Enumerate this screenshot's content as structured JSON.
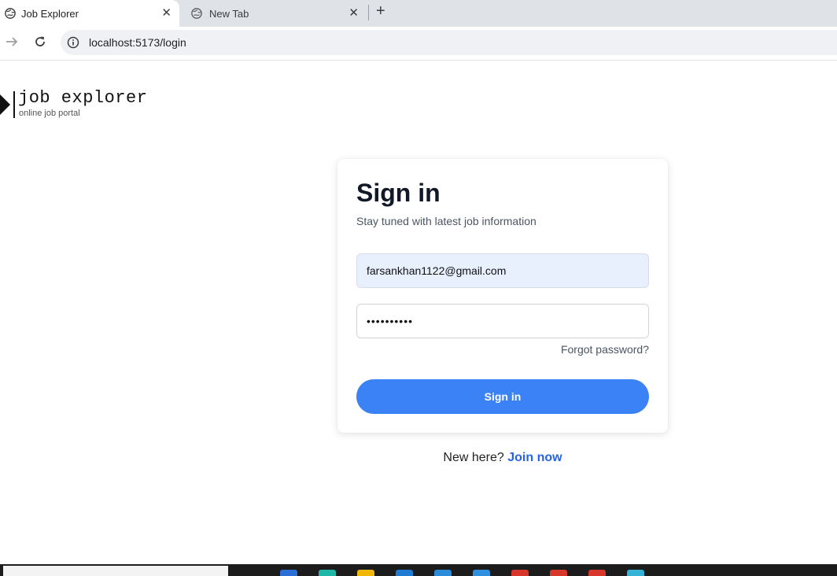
{
  "browser": {
    "tabs": [
      {
        "title": "Job Explorer",
        "active": true
      },
      {
        "title": "New Tab",
        "active": false
      }
    ],
    "url": "localhost:5173/login"
  },
  "logo": {
    "brand": "job explorer",
    "tagline": "online job portal"
  },
  "signin": {
    "heading": "Sign in",
    "subtitle": "Stay tuned with latest job information",
    "email_value": "farsankhan1122@gmail.com",
    "password_value": "••••••••••",
    "forgot_label": "Forgot password?",
    "button_label": "Sign in"
  },
  "signup": {
    "prompt": "New here?",
    "link_label": "Join now"
  },
  "colors": {
    "accent": "#3b82f6",
    "link": "#2563eb",
    "autofill_bg": "#e8f0fe"
  },
  "taskbar": {
    "icons": [
      "edge-icon",
      "chrome-icon",
      "file-explorer-icon",
      "mail-icon",
      "vscode-icon",
      "app-icon",
      "app-icon",
      "app-icon",
      "app-icon",
      "app-icon"
    ]
  }
}
